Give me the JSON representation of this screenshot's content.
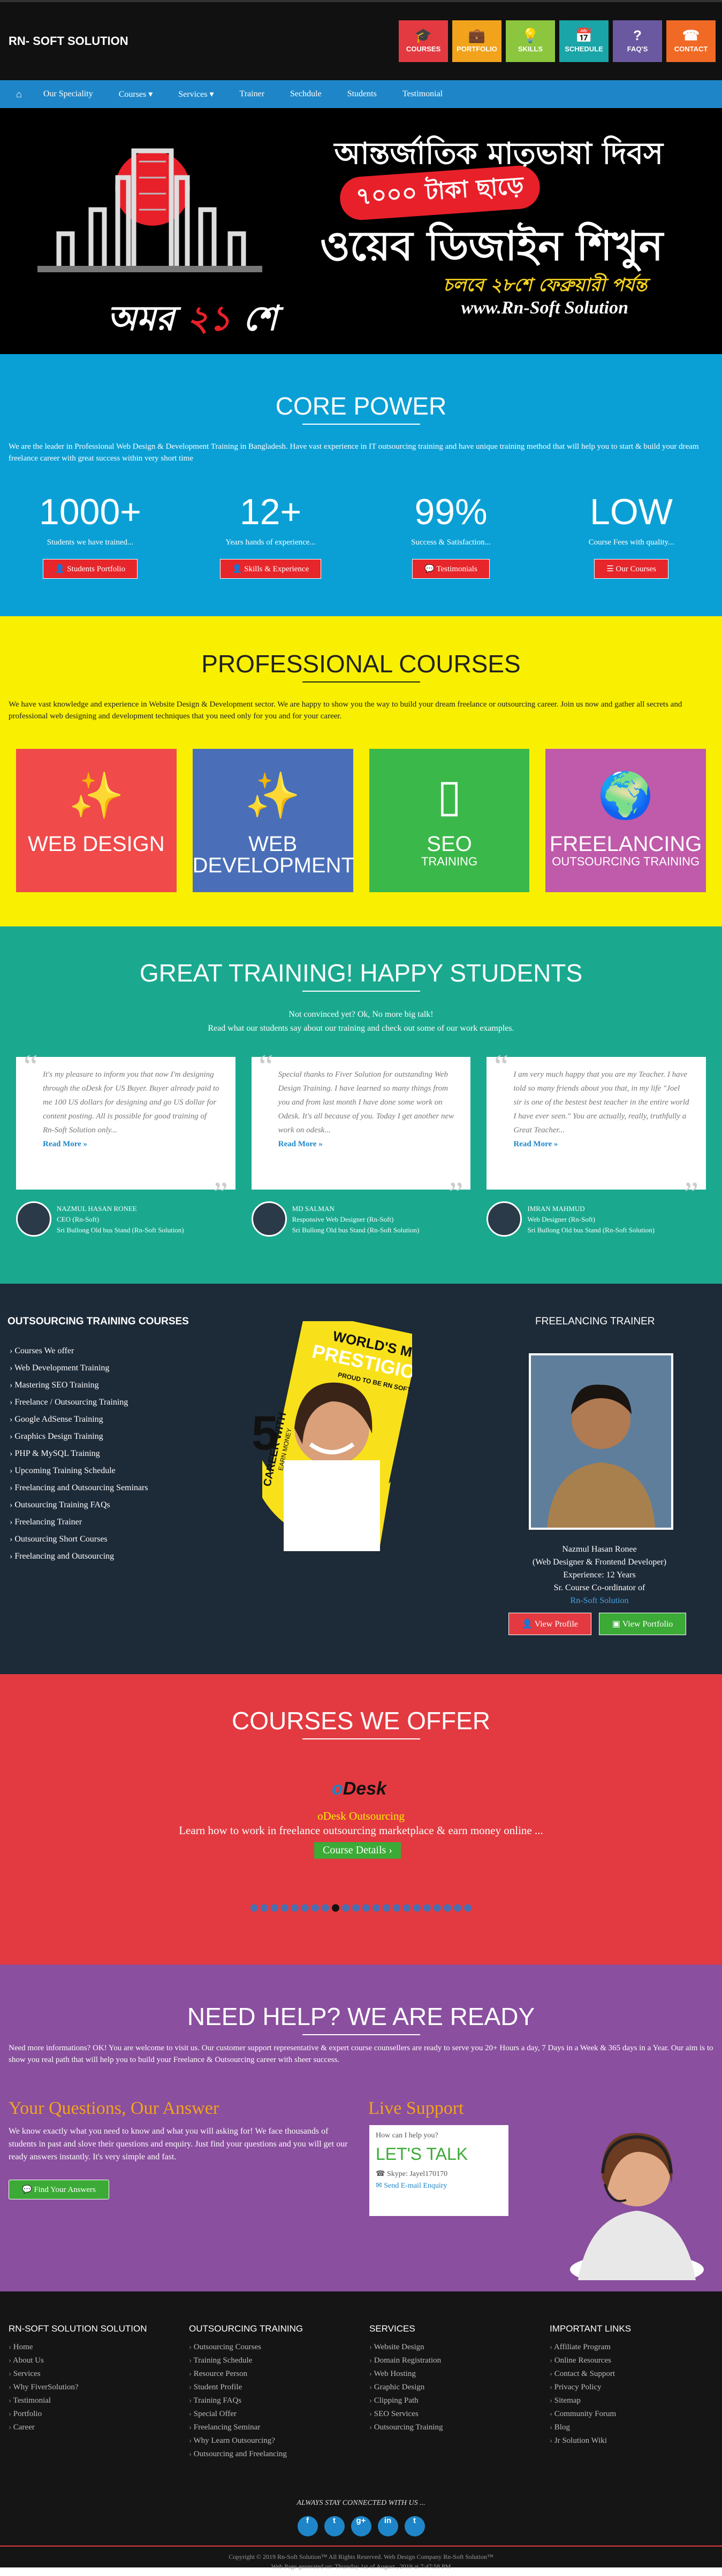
{
  "header": {
    "logo": "RN- SOFT SOLUTION",
    "buttons": [
      {
        "label": "COURSES",
        "color": "#e33a41",
        "icon": "graduation-icon",
        "glyph": "🎓"
      },
      {
        "label": "PORTFOLIO",
        "color": "#f2a31c",
        "icon": "briefcase-icon",
        "glyph": "💼"
      },
      {
        "label": "SKILLS",
        "color": "#8cc63e",
        "icon": "bulb-icon",
        "glyph": "💡"
      },
      {
        "label": "SCHEDULE",
        "color": "#1aa5a8",
        "icon": "calendar-icon",
        "glyph": "📅"
      },
      {
        "label": "FAQ'S",
        "color": "#6a59a0",
        "icon": "question-icon",
        "glyph": "?"
      },
      {
        "label": "CONTACT",
        "color": "#f06a26",
        "icon": "phone-icon",
        "glyph": "☎"
      }
    ]
  },
  "nav": {
    "home_icon": "home-icon",
    "items": [
      "Our Speciality",
      "Courses ▾",
      "Services ▾",
      "Trainer",
      "Sechdule",
      "Students",
      "Testimonial"
    ]
  },
  "banner": {
    "line1": "আন্তর্জাতিক মাতৃভাষা দিবস",
    "line2": "৭০০০ টাকা ছাড়ে",
    "line3": "ওয়েব ডিজাইন শিখুন",
    "line4": "চলবে ২৮শে ফেব্রুয়ারী পর্যন্ত",
    "line5": "www.Rn-Soft Solution",
    "omor_a": "অমর ",
    "omor_b": "২১",
    "omor_c": " শে"
  },
  "core": {
    "title": "CORE POWER",
    "lead": "We are the leader in Professional Web Design & Development Training in Bangladesh. Have vast experience in IT outsourcing training and have unique training method that will help you to start & build your dream freelance career with great success within very short time",
    "stats": [
      {
        "n": "1000+",
        "d": "Students we have trained...",
        "btn": "👤 Students Portfolio"
      },
      {
        "n": "12+",
        "d": "Years hands of experience...",
        "btn": "👤 Skills & Experience"
      },
      {
        "n": "99%",
        "d": "Success & Satisfaction...",
        "btn": "💬 Testimonials"
      },
      {
        "n": "LOW",
        "d": "Course Fees with quality...",
        "btn": "☰ Our Courses"
      }
    ]
  },
  "prof": {
    "title": "PROFESSIONAL COURSES",
    "lead": "We have vast knowledge and experience in Website Design & Development sector. We are happy to show you the way to build your dream freelance or outsourcing career. Join us now and gather all secrets and professional web designing and development techniques that you need only for you and for your career.",
    "cards": [
      {
        "t": "WEB DESIGN",
        "s": "",
        "color": "#f04a4a",
        "glyph": "✨"
      },
      {
        "t": "WEB DEVELOPMENT",
        "s": "",
        "color": "#4a6fb8",
        "glyph": "✨"
      },
      {
        "t": "SEO",
        "s": "TRAINING",
        "color": "#3bb84a",
        "glyph": "▯"
      },
      {
        "t": "FREELANCING",
        "s": "OUTSOURCING TRAINING",
        "color": "#c05aaa",
        "glyph": "🌍"
      }
    ]
  },
  "testi": {
    "title": "GREAT TRAINING! HAPPY STUDENTS",
    "sub1": "Not convinced yet? Ok, No more big talk!",
    "sub2": "Read what our students say about our training and check out some of our work examples.",
    "items": [
      {
        "text": "It's my pleasure to inform you that now I'm designing through the oDesk for US Buyer. Buyer already paid to me 100 US dollars for designing and go US dollar for content posting. All is possible for good training of Rn-Soft Solution only...",
        "more": "Read More »",
        "name": "NAZMUL HASAN RONEE",
        "role": "CEO (Rn-Soft)",
        "addr": "Sri Bullong Old bus Stand (Rn-Soft Solution)"
      },
      {
        "text": "Special thanks to Fiver Solution for outstanding Web Design Training. I have learned so many things from you and from last month I have done some work on Odesk. It's all because of you. Today I get another new work on odesk...",
        "more": "Read More »",
        "name": "MD SALMAN",
        "role": "Responsive Web Designer (Rn-Soft)",
        "addr": "Sri Bullong Old bus Stand (Rn-Soft Solution)"
      },
      {
        "text": "I am very much happy that you are my Teacher. I have told so many friends about you that, in my life \"Joel sir is one of the bestest best teacher in the entire world I have ever seen.\" You are actually, really, truthfully a Great Teacher...",
        "more": "Read More »",
        "name": "IMRAN MAHMUD",
        "role": "Web Designer (Rn-Soft)",
        "addr": "Sri Bullong Old bus Stand (Rn-Soft Solution)"
      }
    ]
  },
  "dark": {
    "title": "OUTSOURCING TRAINING COURSES",
    "list": [
      "Courses We offer",
      "Web Development Training",
      "Mastering SEO Training",
      "Freelance / Outsourcing Training",
      "Google AdSense Training",
      "Graphics Design Training",
      "PHP & MySQL Training",
      "Upcoming Training Schedule",
      "Freelancing and Outsourcing Seminars",
      "Outsourcing Training FAQs",
      "Freelancing Trainer",
      "Outsourcing Short Courses",
      "Freelancing and Outsourcing"
    ],
    "poster_top": "WORLD'S MOST",
    "poster_mid": "PRESTIGIOUS",
    "poster_sub": "PROUD TO BE RN SOFT",
    "poster_left": "CAREER WITH",
    "poster_left2": "EARN MONEY",
    "poster_num": "5",
    "trainer_title": "FREELANCING TRAINER",
    "trainer_name": "Nazmul Hasan Ronee",
    "trainer_role": "(Web Designer & Frontend Developer)",
    "trainer_exp": "Experience: 12 Years",
    "trainer_pos": "Sr. Course Co-ordinator of",
    "trainer_link": "Rn-Soft Solution",
    "btn_profile": "👤 View Profile",
    "btn_portfolio": "▣ View Portfolio"
  },
  "offer": {
    "title": "COURSES WE OFFER",
    "logo_a": "o",
    "logo_b": "Desk",
    "name": "oDesk Outsourcing",
    "desc": "Learn how to work in freelance outsourcing marketplace & earn money online ...",
    "btn": "Course Details ›",
    "dots": 22,
    "active": 8
  },
  "help": {
    "title": "NEED HELP? WE ARE READY",
    "lead": "Need more informations? OK! You are welcome to visit us. Our customer support representative & expert course counsellers are ready to serve you 20+ Hours a day, 7 Days in a Week & 365 days in a Year. Our aim is to show you real path that will help you to build your Freelance & Outsourcing career with sheer success.",
    "qa_title": "Your Questions, Our Answer",
    "qa_text": "We know exactly what you need to know and what you will asking for! We face thousands of students in past and slove their questions and enquiry. Just find your questions and you will get our ready answers instantly. It's very simple and fast.",
    "qa_btn": "💬 Find Your Answers",
    "live_title": "Live Support",
    "chat_q": "How can I help you?",
    "chat_t": "LET'S TALK",
    "chat_skype": "☎ Skype: Jayel170170",
    "chat_mail": "✉ Send E-mail Enquiry"
  },
  "footer": {
    "cols": [
      {
        "h": "RN-SOFT SOLUTION SOLUTION",
        "items": [
          "Home",
          "About Us",
          "Services",
          "Why FiverSolution?",
          "Testimonial",
          "Portfolio",
          "Career"
        ]
      },
      {
        "h": "OUTSOURCING TRAINING",
        "items": [
          "Outsourcing Courses",
          "Training Schedule",
          "Resource Person",
          "Student Profile",
          "Training FAQs",
          "Special Offer",
          "Freelancing Seminar",
          "Why Learn Outsourcing?",
          "Outsourcing and Freelancing"
        ]
      },
      {
        "h": "SERVICES",
        "items": [
          "Website Design",
          "Domain Registration",
          "Web Hosting",
          "Graphic Design",
          "Clipping Path",
          "SEO Services",
          "Outsourcing Training"
        ]
      },
      {
        "h": "IMPORTANT LINKS",
        "items": [
          "Affiliate Program",
          "Online Resources",
          "Contact & Support",
          "Privacy Policy",
          "Sitemap",
          "Community Forum",
          "Blog",
          "Jr Solution Wiki"
        ]
      }
    ],
    "social_title": "ALWAYS STAY CONNECTED WITH US ...",
    "social": [
      "f",
      "t",
      "g+",
      "in",
      "t"
    ],
    "copy1": "Copyright © 2019 Rn-Soft Solution™ All Rights Reserved. Web Design Company Rn-Soft Solution™",
    "copy2": "Web Page generated on: Thursday 1st of August , 2019 at 7:47:58 PM"
  }
}
